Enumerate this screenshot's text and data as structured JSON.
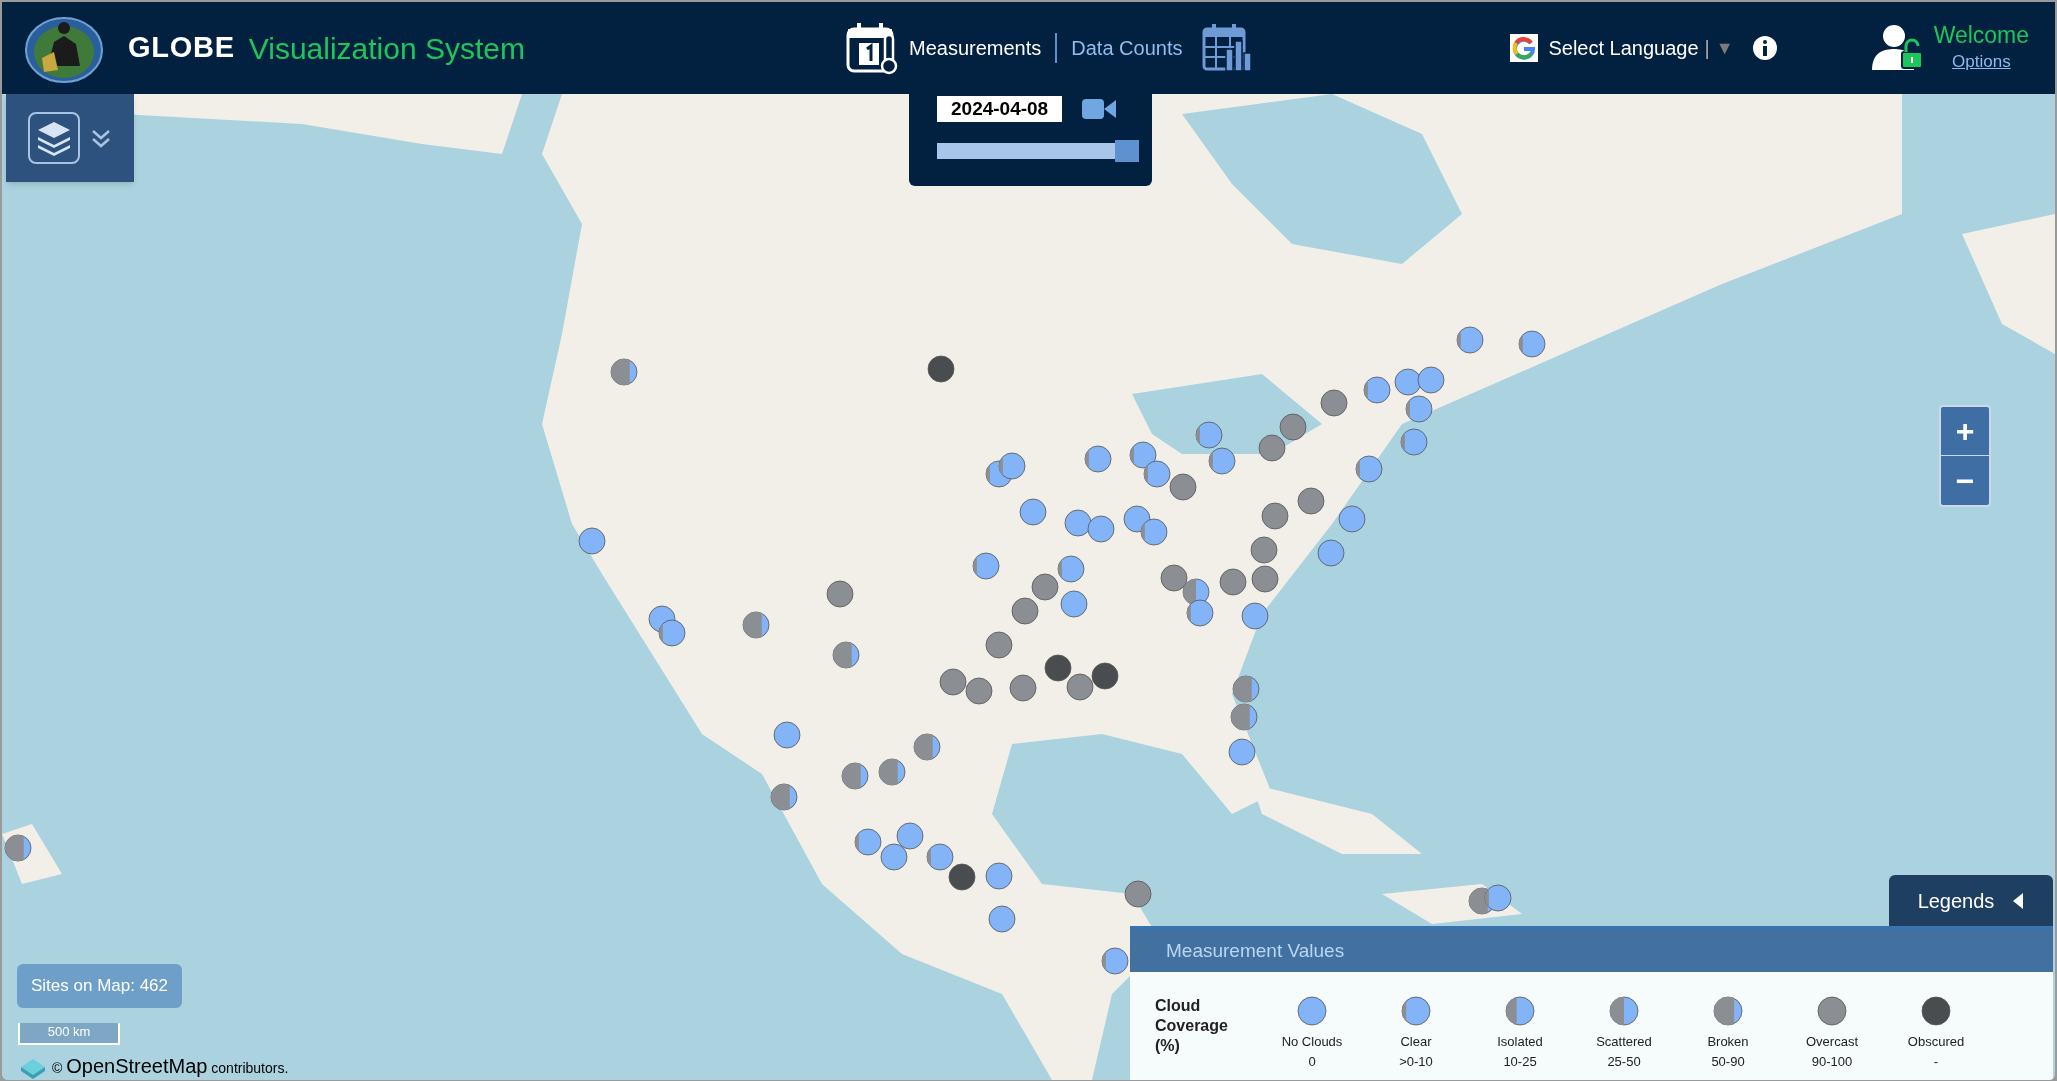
{
  "header": {
    "title_bold": "GLOBE",
    "title_rest": "Visualization System",
    "nav": [
      {
        "label": "Measurements",
        "selected": true
      },
      {
        "label": "Data Counts",
        "selected": false
      }
    ],
    "language": {
      "label": "Select Language",
      "separator": "|",
      "caret": "▼"
    },
    "user": {
      "greeting": "Welcome",
      "link": "Options"
    }
  },
  "date_control": {
    "value": "2024-04-08",
    "level": 1
  },
  "zoom": {
    "in": "+",
    "out": "−"
  },
  "markers": [
    {
      "kind": "broken"
    },
    {
      "kind": "obscured"
    },
    {
      "kind": "no_clouds"
    },
    {
      "kind": "no_clouds"
    },
    {
      "kind": "clear"
    },
    {
      "kind": "broken"
    },
    {
      "kind": "overcast"
    },
    {
      "kind": "broken"
    },
    {
      "kind": "no_clouds"
    },
    {
      "kind": "broken"
    },
    {
      "kind": "broken"
    },
    {
      "kind": "broken"
    },
    {
      "kind": "broken"
    },
    {
      "kind": "clear"
    },
    {
      "kind": "no_clouds"
    },
    {
      "kind": "no_clouds"
    },
    {
      "kind": "clear"
    },
    {
      "kind": "obscured"
    },
    {
      "kind": "no_clouds"
    },
    {
      "kind": "no_clouds"
    },
    {
      "kind": "clear"
    },
    {
      "kind": "clear"
    },
    {
      "kind": "no_clouds"
    },
    {
      "kind": "no_clouds"
    },
    {
      "kind": "no_clouds"
    },
    {
      "kind": "clear"
    },
    {
      "kind": "clear"
    },
    {
      "kind": "no_clouds"
    },
    {
      "kind": "clear"
    },
    {
      "kind": "clear"
    },
    {
      "kind": "overcast"
    },
    {
      "kind": "clear"
    },
    {
      "kind": "no_clouds"
    },
    {
      "kind": "overcast"
    },
    {
      "kind": "overcast"
    },
    {
      "kind": "overcast"
    },
    {
      "kind": "overcast"
    },
    {
      "kind": "overcast"
    },
    {
      "kind": "obscured"
    },
    {
      "kind": "overcast"
    },
    {
      "kind": "obscured"
    },
    {
      "kind": "overcast"
    },
    {
      "kind": "scattered"
    },
    {
      "kind": "overcast"
    },
    {
      "kind": "overcast"
    },
    {
      "kind": "no_clouds"
    },
    {
      "kind": "clear"
    },
    {
      "kind": "broken"
    },
    {
      "kind": "broken"
    },
    {
      "kind": "no_clouds"
    },
    {
      "kind": "clear"
    },
    {
      "kind": "clear"
    },
    {
      "kind": "overcast"
    },
    {
      "kind": "overcast"
    },
    {
      "kind": "overcast"
    },
    {
      "kind": "clear"
    },
    {
      "kind": "no_clouds"
    },
    {
      "kind": "no_clouds"
    },
    {
      "kind": "clear"
    },
    {
      "kind": "clear"
    },
    {
      "kind": "clear"
    },
    {
      "kind": "no_clouds"
    },
    {
      "kind": "no_clouds"
    },
    {
      "kind": "overcast"
    },
    {
      "kind": "overcast"
    },
    {
      "kind": "overcast"
    },
    {
      "kind": "clear"
    },
    {
      "kind": "clear"
    },
    {
      "kind": "broken"
    },
    {
      "kind": "clear"
    },
    {
      "kind": "overcast"
    },
    {
      "kind": "clear"
    },
    {
      "kind": "broken"
    },
    {
      "kind": "overcast"
    },
    {
      "kind": "clear"
    }
  ],
  "sites_count": "Sites on Map: 462",
  "scale": "500 km",
  "attribution": {
    "symbol": "©",
    "name": "OpenStreetMap",
    "rest": "contributors."
  },
  "legends_tab": {
    "label": "Legends",
    "expanded": true
  },
  "legend": {
    "title": "Measurement Values",
    "row_label": [
      "Cloud",
      "Coverage",
      "(%)"
    ],
    "items": [
      {
        "kind": "no_clouds",
        "name": "No Clouds",
        "range": "0"
      },
      {
        "kind": "clear",
        "name": "Clear",
        "range": ">0-10"
      },
      {
        "kind": "isolated",
        "name": "Isolated",
        "range": "10-25"
      },
      {
        "kind": "scattered",
        "name": "Scattered",
        "range": "25-50"
      },
      {
        "kind": "broken",
        "name": "Broken",
        "range": "50-90"
      },
      {
        "kind": "overcast",
        "name": "Overcast",
        "range": "90-100"
      },
      {
        "kind": "obscured",
        "name": "Obscured",
        "range": "-"
      }
    ]
  }
}
